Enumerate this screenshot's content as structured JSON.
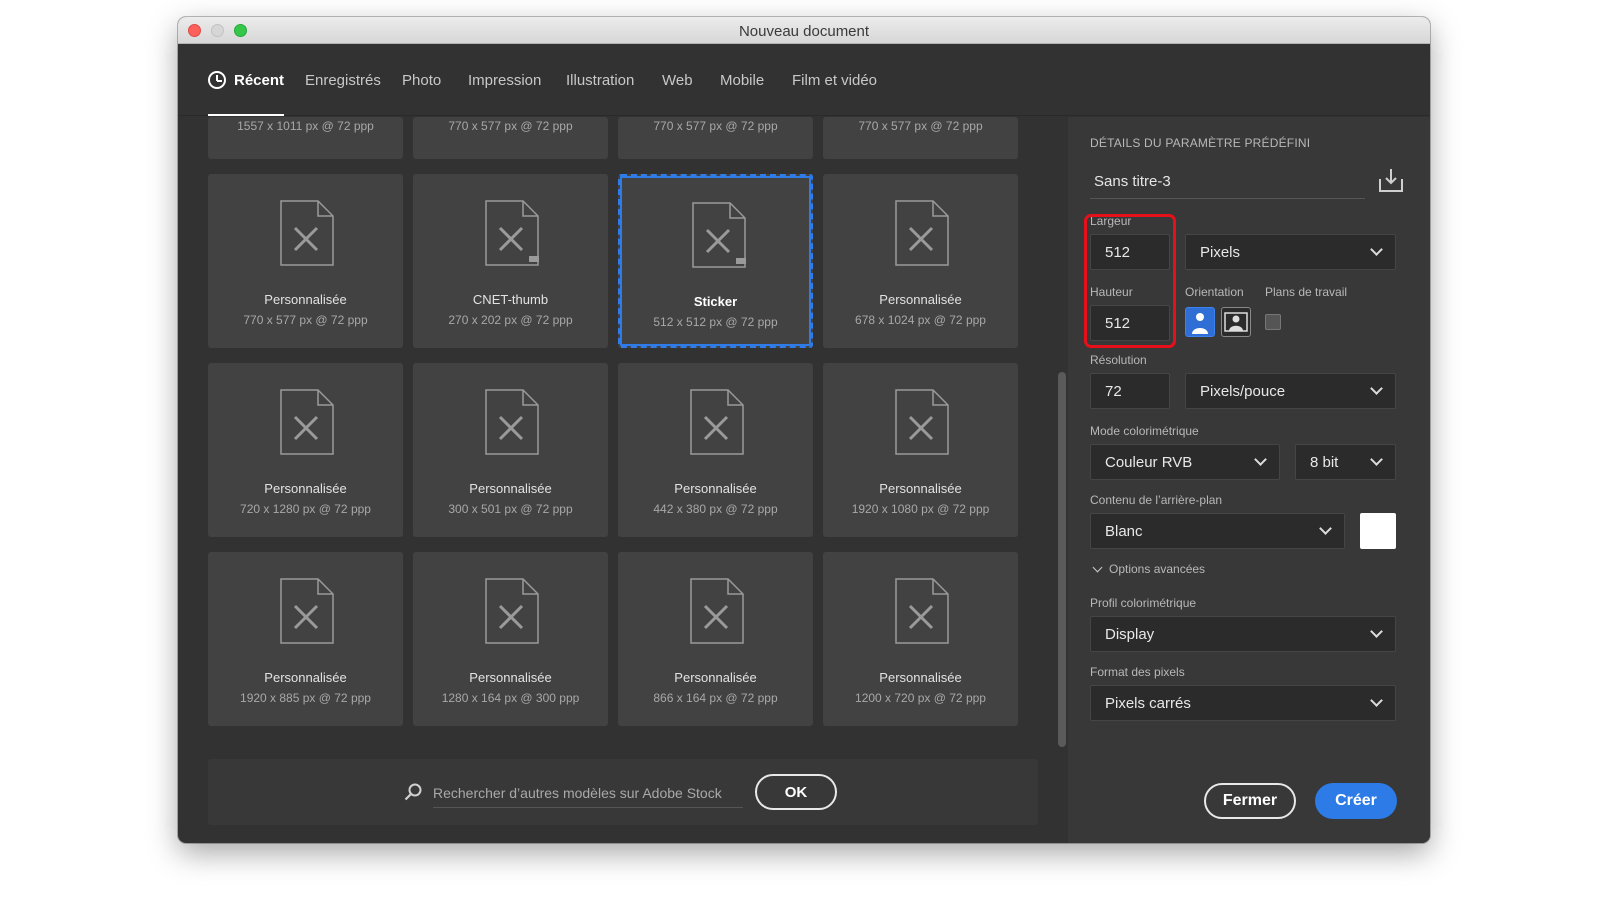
{
  "window": {
    "title": "Nouveau document"
  },
  "tabs": [
    {
      "label": "Récent",
      "active": true
    },
    {
      "label": "Enregistrés"
    },
    {
      "label": "Photo"
    },
    {
      "label": "Impression"
    },
    {
      "label": "Illustration"
    },
    {
      "label": "Web"
    },
    {
      "label": "Mobile"
    },
    {
      "label": "Film et vidéo"
    }
  ],
  "partial_row": [
    {
      "dims": "1557 x 1011 px @ 72 ppp"
    },
    {
      "dims": "770 x 577 px @ 72 ppp"
    },
    {
      "dims": "770 x 577 px @ 72 ppp"
    },
    {
      "dims": "770 x 577 px @ 72 ppp"
    }
  ],
  "presets": [
    {
      "name": "Personnalisée",
      "dims": "770 x 577 px @ 72 ppp"
    },
    {
      "name": "CNET-thumb",
      "dims": "270 x 202 px @ 72 ppp"
    },
    {
      "name": "Sticker",
      "dims": "512 x 512 px @ 72 ppp",
      "selected": true
    },
    {
      "name": "Personnalisée",
      "dims": "678 x 1024 px @ 72 ppp"
    },
    {
      "name": "Personnalisée",
      "dims": "720 x 1280 px @ 72 ppp"
    },
    {
      "name": "Personnalisée",
      "dims": "300 x 501 px @ 72 ppp"
    },
    {
      "name": "Personnalisée",
      "dims": "442 x 380 px @ 72 ppp"
    },
    {
      "name": "Personnalisée",
      "dims": "1920 x 1080 px @ 72 ppp"
    },
    {
      "name": "Personnalisée",
      "dims": "1920 x 885 px @ 72 ppp"
    },
    {
      "name": "Personnalisée",
      "dims": "1280 x 164 px @ 300 ppp"
    },
    {
      "name": "Personnalisée",
      "dims": "866 x 164 px @ 72 ppp"
    },
    {
      "name": "Personnalisée",
      "dims": "1200 x 720 px @ 72 ppp"
    }
  ],
  "search": {
    "placeholder": "Rechercher d’autres modèles sur Adobe Stock",
    "ok_label": "OK"
  },
  "details": {
    "heading": "DÉTAILS DU PARAMÈTRE PRÉDÉFINI",
    "preset_name": "Sans titre-3",
    "width_label": "Largeur",
    "width_value": "512",
    "width_unit": "Pixels",
    "height_label": "Hauteur",
    "height_value": "512",
    "orientation_label": "Orientation",
    "artboards_label": "Plans de travail",
    "resolution_label": "Résolution",
    "resolution_value": "72",
    "resolution_unit": "Pixels/pouce",
    "color_mode_label": "Mode colorimétrique",
    "color_mode_value": "Couleur RVB",
    "bit_depth": "8 bit",
    "background_label": "Contenu de l’arrière-plan",
    "background_value": "Blanc",
    "background_swatch": "#ffffff",
    "advanced_label": "Options avancées",
    "profile_label": "Profil colorimétrique",
    "profile_value": "Display",
    "pixel_format_label": "Format des pixels",
    "pixel_format_value": "Pixels carrés"
  },
  "buttons": {
    "close": "Fermer",
    "create": "Créer"
  },
  "colors": {
    "accent": "#2d7be6",
    "highlight": "#e6101a",
    "selection": "#2f7be8"
  }
}
